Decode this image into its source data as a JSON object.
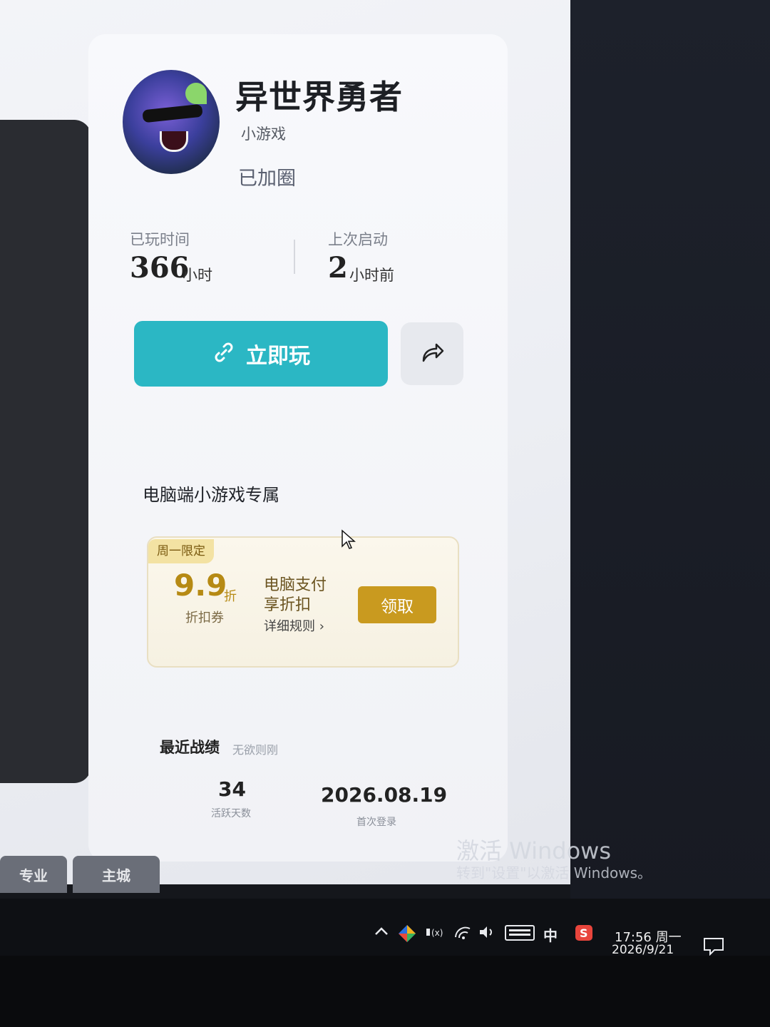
{
  "game": {
    "title": "异世界勇者",
    "tag": "小游戏",
    "status": "已加圈"
  },
  "stats": {
    "played_label": "已玩时间",
    "played_value": "366",
    "played_unit": "小时",
    "last_label": "上次启动",
    "last_value": "2",
    "last_unit": "小时前"
  },
  "actions": {
    "play_label": "立即玩"
  },
  "promo": {
    "section_title": "电脑端小游戏专属",
    "badge": "周一限定",
    "discount": "9.9",
    "discount_unit": "折",
    "coupon_type": "折扣券",
    "line1": "电脑支付",
    "line2": "享折扣",
    "rules": "详细规则 ›",
    "claim": "领取"
  },
  "recent": {
    "title": "最近战绩",
    "subtitle": "无欲则刚",
    "active_days_value": "34",
    "active_days_label": "活跃天数",
    "first_login_value": "2026.08.19",
    "first_login_label": "首次登录"
  },
  "bottom_tabs": [
    "专业",
    "主城"
  ],
  "watermark": {
    "line1": "激活 Windows",
    "line2": "转到\"设置\"以激活 Windows。"
  },
  "taskbar": {
    "ime": "中",
    "time": "17:56 周一",
    "date": "2026/9/21"
  },
  "colors": {
    "play_button": "#2bb7c4",
    "claim_button": "#c99a1f",
    "coupon_text": "#b68a14"
  }
}
